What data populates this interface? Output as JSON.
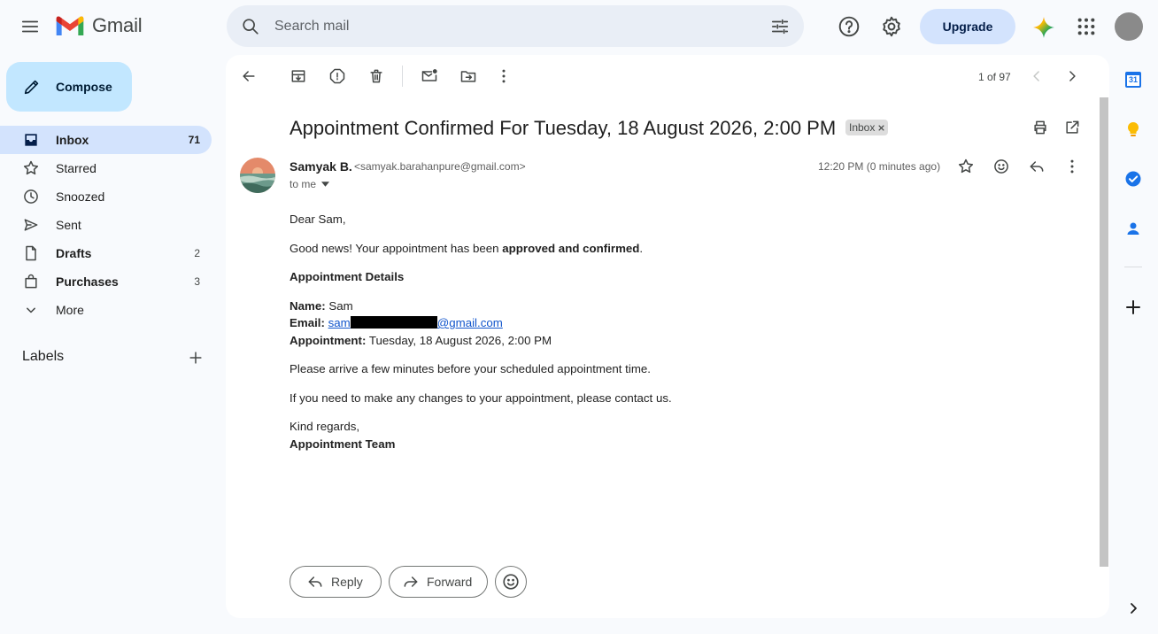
{
  "app": {
    "name": "Gmail"
  },
  "search": {
    "placeholder": "Search mail"
  },
  "header": {
    "upgrade_label": "Upgrade"
  },
  "compose": {
    "label": "Compose"
  },
  "nav": [
    {
      "label": "Inbox",
      "count": "71"
    },
    {
      "label": "Starred",
      "count": ""
    },
    {
      "label": "Snoozed",
      "count": ""
    },
    {
      "label": "Sent",
      "count": ""
    },
    {
      "label": "Drafts",
      "count": "2"
    },
    {
      "label": "Purchases",
      "count": "3"
    },
    {
      "label": "More",
      "count": ""
    }
  ],
  "labels": {
    "title": "Labels"
  },
  "toolbar": {
    "pager": "1 of 97"
  },
  "email": {
    "subject": "Appointment Confirmed For Tuesday, 18 August 2026, 2:00 PM",
    "label_chip": "Inbox",
    "sender_name": "Samyak B.",
    "sender_email": "<samyak.barahanpure@gmail.com>",
    "recipient": "to me",
    "time": "12:20 PM (0 minutes ago)",
    "body": {
      "greeting": "Dear Sam,",
      "intro_prefix": "Good news! Your appointment has been ",
      "intro_bold": "approved and confirmed",
      "intro_suffix": ".",
      "details_title": "Appointment Details",
      "name_label": "Name:",
      "name_value": " Sam",
      "email_label": "Email:",
      "email_value_prefix": "sam",
      "email_value_suffix": "@gmail.com",
      "appointment_label": "Appointment:",
      "appointment_value": " Tuesday, 18 August 2026, 2:00 PM",
      "arrive_note": "Please arrive a few minutes before your scheduled appointment time.",
      "changes_note": "If you need to make any changes to your appointment, please contact us.",
      "closing": "Kind regards,",
      "signature": "Appointment Team"
    }
  },
  "actions": {
    "reply_label": "Reply",
    "forward_label": "Forward"
  },
  "side_panel": {
    "calendar_day": "31"
  },
  "colors": {
    "accent": "#0b57d0",
    "compose_bg": "#c2e7ff",
    "active_nav_bg": "#d3e3fd",
    "link": "#1155cc"
  }
}
